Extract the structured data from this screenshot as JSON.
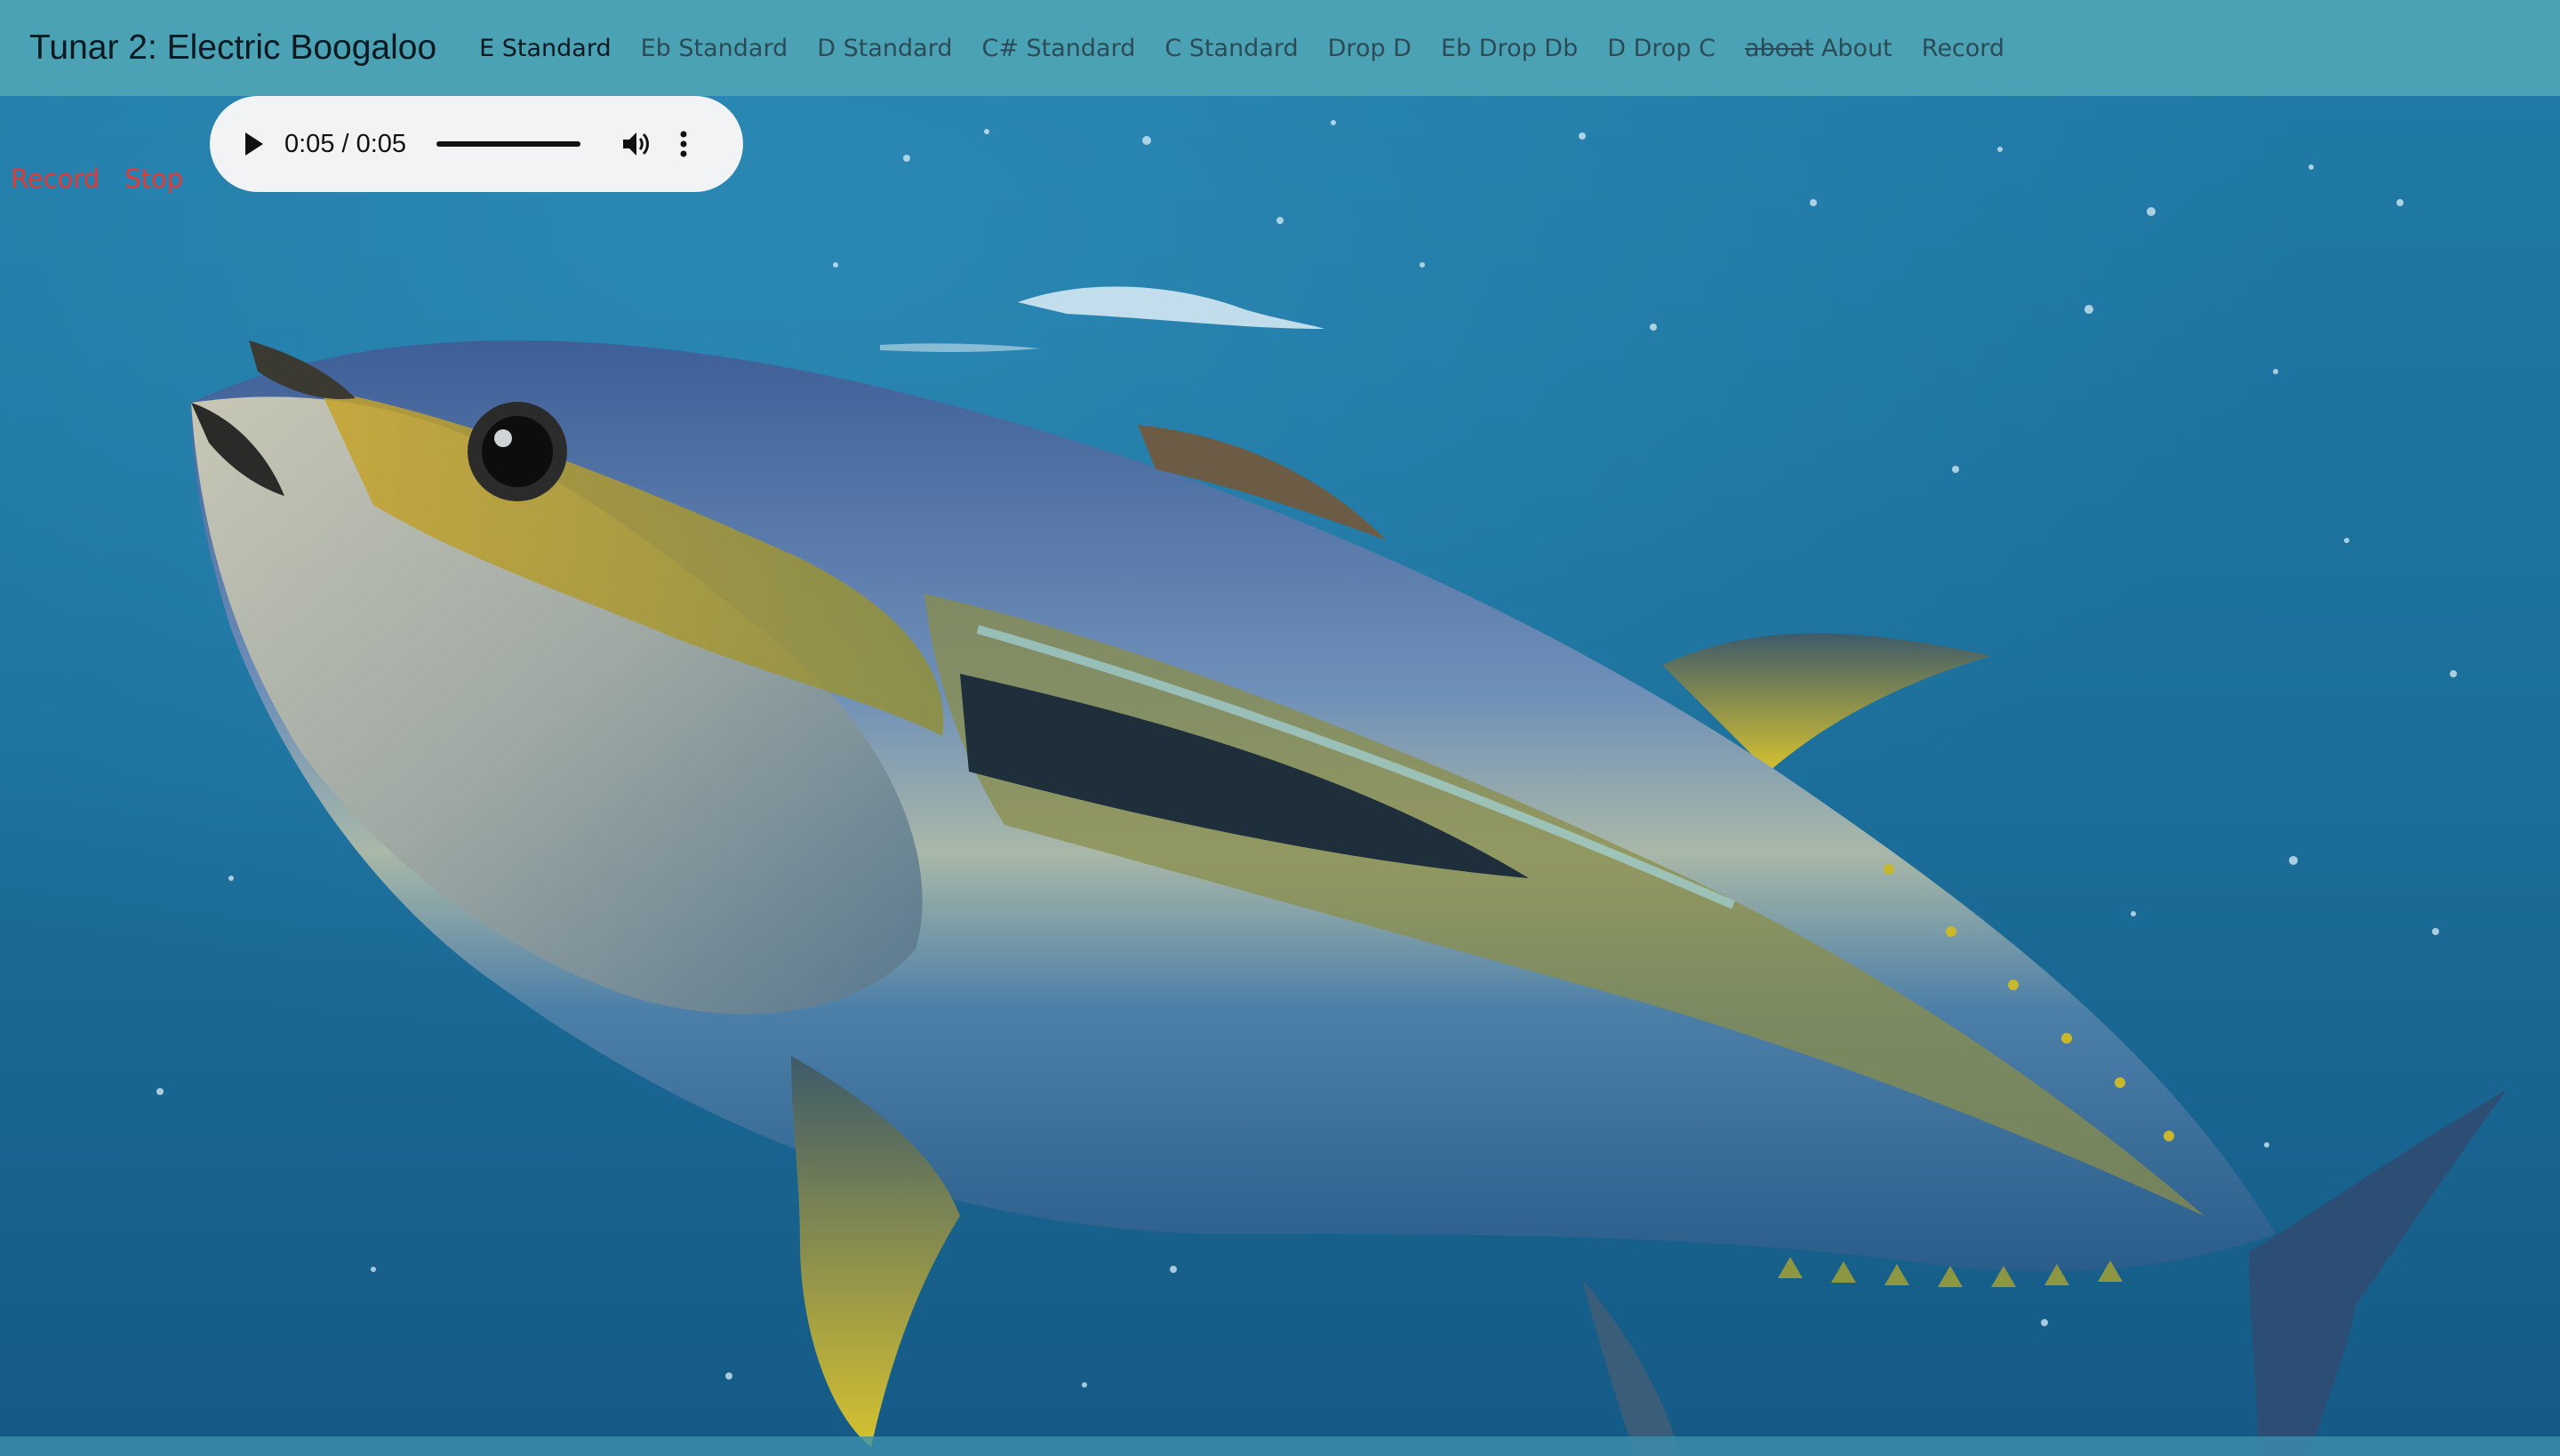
{
  "navbar": {
    "brand": "Tunar 2: Electric Boogaloo",
    "links": [
      {
        "label": "E Standard",
        "active": true
      },
      {
        "label": "Eb Standard"
      },
      {
        "label": "D Standard"
      },
      {
        "label": "C# Standard"
      },
      {
        "label": "C Standard"
      },
      {
        "label": "Drop D"
      },
      {
        "label": "Eb Drop Db"
      },
      {
        "label": "D Drop C"
      },
      {
        "label": "About",
        "strikethrough_prefix": "aboat"
      },
      {
        "label": "Record"
      }
    ]
  },
  "audio_player": {
    "time": "0:05 / 0:05",
    "progress": 1.0,
    "icons": {
      "play": "play-icon",
      "volume": "volume-icon",
      "more": "more-vert-icon"
    }
  },
  "record_controls": {
    "record_label": "Record",
    "stop_label": "Stop"
  },
  "background": {
    "subject": "tuna-fish-underwater",
    "colors": {
      "water": "#1c6f97",
      "navbar": "#4aa2b4",
      "record_text": "#e53935"
    }
  }
}
